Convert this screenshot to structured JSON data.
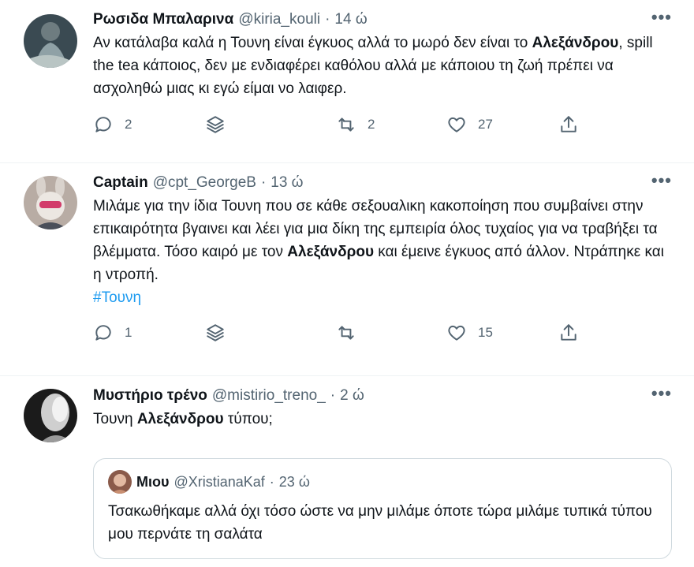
{
  "tweets": [
    {
      "name": "Ρωσιδα Μπαλαρινα",
      "handle": "@kiria_kouli",
      "dot": "·",
      "time": "14 ώ",
      "more": "•••",
      "text_a": "Αν κατάλαβα καλά η Τουνη είναι έγκυος αλλά το μωρό δεν είναι το ",
      "text_bold": "Αλεξάνδρου",
      "text_b": ", spill the tea κάποιος, δεν με ενδιαφέρει καθόλου αλλά με κάποιου τη ζωή πρέπει να ασχοληθώ μιας κι εγώ είμαι νο λαιφερ.",
      "replies": "2",
      "retweets": "2",
      "likes": "27"
    },
    {
      "name": "Captain",
      "handle": "@cpt_GeorgeB",
      "dot": "·",
      "time": "13 ώ",
      "more": "•••",
      "text_a": "Μιλάμε για την ίδια Τουνη που σε κάθε σεξουαλικη κακοποίηση που συμβαίνει στην επικαιρότητα βγαινει και λέει για μια δίκη της εμπειρία όλος τυχαίος για να τραβήξει τα βλέμματα. Τόσο καιρό με τον ",
      "text_bold": "Αλεξάνδρου",
      "text_b": " και έμεινε έγκυος από άλλον. Ντράπηκε και η ντροπή.",
      "hashtag": "#Τουνη",
      "replies": "1",
      "retweets": "",
      "likes": "15"
    },
    {
      "name": "Μυστήριο τρένο",
      "handle": "@mistirio_treno_",
      "dot": "·",
      "time": "2 ώ",
      "more": "•••",
      "text_a": "Τουνη ",
      "text_bold": "Αλεξάνδρου",
      "text_b": " τύπου;",
      "quote": {
        "name": "Μιου",
        "handle": "@XristianaKaf",
        "dot": "·",
        "time": "23 ώ",
        "text": "Τσακωθήκαμε αλλά όχι τόσο ώστε να μην μιλάμε όποτε τώρα μιλάμε τυπικά τύπου μου περνάτε τη σαλάτα"
      }
    }
  ],
  "icons": {
    "reply": "reply-icon",
    "stack": "layers-icon",
    "retweet": "retweet-icon",
    "like": "heart-icon",
    "share": "share-icon",
    "more": "more-icon"
  },
  "colors": {
    "text": "#0f1419",
    "secondary": "#536471",
    "link": "#1d9bf0",
    "border": "#eff3f4"
  }
}
